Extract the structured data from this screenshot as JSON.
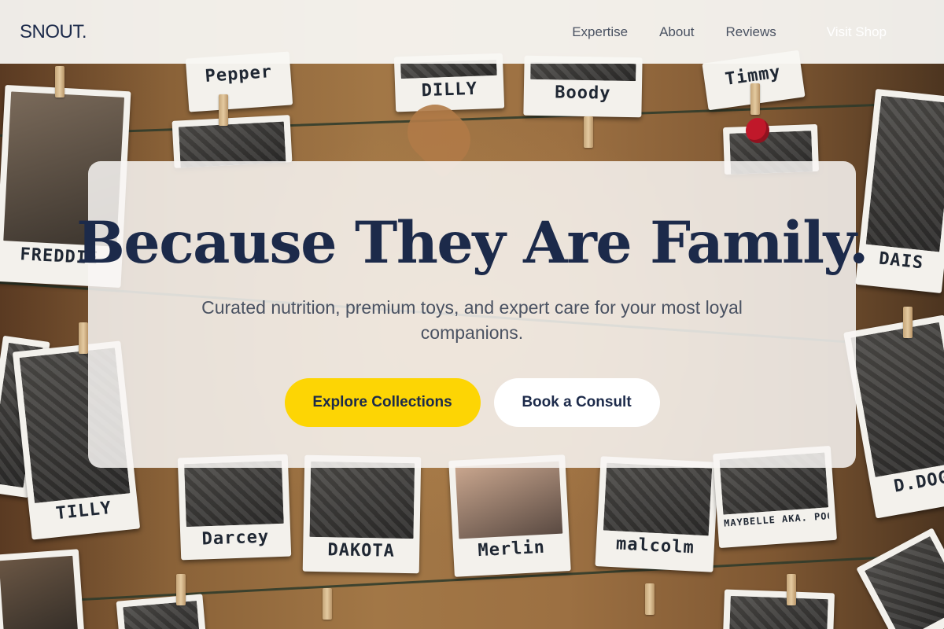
{
  "nav": {
    "logo": "SNOUT.",
    "links": [
      "Expertise",
      "About",
      "Reviews"
    ],
    "cta": "Visit Shop"
  },
  "hero": {
    "title": "Because They Are Family.",
    "subtitle": "Curated nutrition, premium toys, and expert care for your most loyal companions.",
    "primary_button": "Explore Collections",
    "secondary_button": "Book a Consult"
  },
  "background": {
    "photo_captions": [
      "Pepper",
      "DILLY",
      "Boody",
      "Timmy",
      "FREDDIE",
      "DAIS",
      "TILLY",
      "Darcey",
      "DAKOTA",
      "Merlin",
      "malcolm",
      "MAYBELLE AKA. POOCH FACE!",
      "D.DOG"
    ]
  },
  "colors": {
    "navy": "#1c2a4a",
    "accent_yellow": "#fdd504",
    "muted_text": "#4a5262"
  }
}
